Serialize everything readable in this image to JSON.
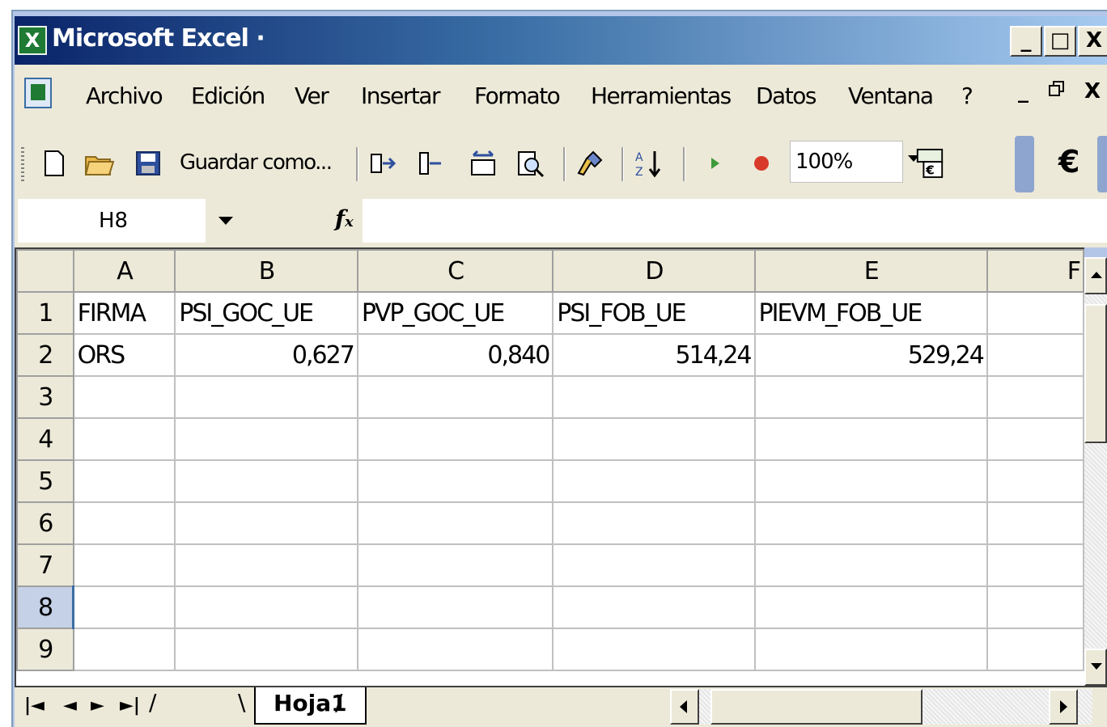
{
  "window": {
    "title": "Microsoft Excel ·",
    "minimize": "_",
    "maximize": "□",
    "close": "X"
  },
  "menu": {
    "items": [
      "Archivo",
      "Edición",
      "Ver",
      "Insertar",
      "Formato",
      "Herramientas",
      "Datos",
      "Ventana",
      "?"
    ],
    "doc_minimize": "_",
    "doc_restore": "🗗",
    "doc_close": "X"
  },
  "toolbar": {
    "save_as_label": "Guardar como...",
    "zoom": "100%",
    "euro": "€"
  },
  "formula_bar": {
    "name_box": "H8",
    "fx": "fx",
    "formula": ""
  },
  "grid": {
    "columns": [
      "A",
      "B",
      "C",
      "D",
      "E",
      "F"
    ],
    "rows": [
      {
        "n": "1",
        "cells": [
          "FIRMA",
          "PSI_GOC_UE",
          "PVP_GOC_UE",
          "PSI_FOB_UE",
          "PIEVM_FOB_UE",
          ""
        ]
      },
      {
        "n": "2",
        "cells": [
          "ORS",
          "0,627",
          "0,840",
          "514,24",
          "529,24",
          ""
        ]
      },
      {
        "n": "3",
        "cells": [
          "",
          "",
          "",
          "",
          "",
          ""
        ]
      },
      {
        "n": "4",
        "cells": [
          "",
          "",
          "",
          "",
          "",
          ""
        ]
      },
      {
        "n": "5",
        "cells": [
          "",
          "",
          "",
          "",
          "",
          ""
        ]
      },
      {
        "n": "6",
        "cells": [
          "",
          "",
          "",
          "",
          "",
          ""
        ]
      },
      {
        "n": "7",
        "cells": [
          "",
          "",
          "",
          "",
          "",
          ""
        ]
      },
      {
        "n": "8",
        "cells": [
          "",
          "",
          "",
          "",
          "",
          ""
        ]
      },
      {
        "n": "9",
        "cells": [
          "",
          "",
          "",
          "",
          "",
          ""
        ]
      }
    ],
    "active_row": "8"
  },
  "sheet_tabs": {
    "nav": [
      "◄◄",
      "◄",
      "►",
      "►►"
    ],
    "active_tab": "Hoja1"
  },
  "colors": {
    "title_gradient_start": "#0a246a",
    "title_gradient_end": "#a6caf0",
    "chrome": "#ece9d8"
  }
}
